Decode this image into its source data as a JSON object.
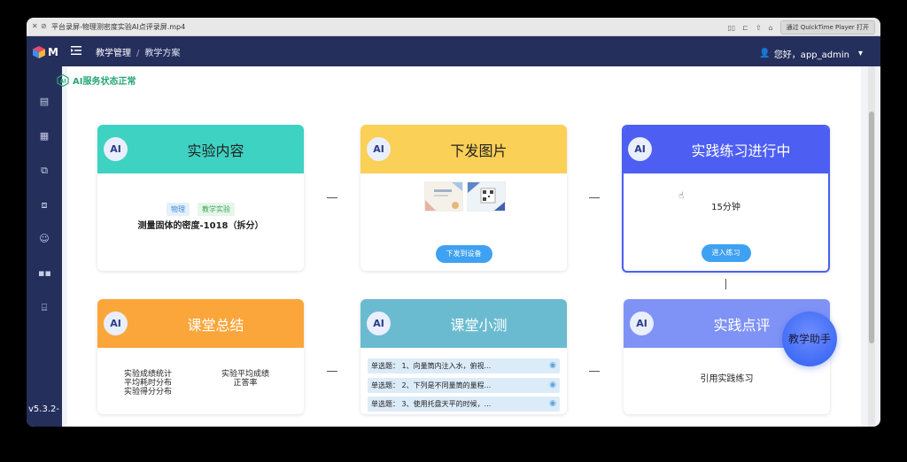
{
  "titlebar": {
    "title": "平台录屏-物理测密度实验AI点评录屏.mp4",
    "open_with_label": "通过 QuickTime Player 打开"
  },
  "sidebar": {
    "logo_text": "M",
    "version": "v5.3.2-",
    "items": [
      {
        "icon": "building-icon"
      },
      {
        "icon": "document-icon"
      },
      {
        "icon": "copy-icon"
      },
      {
        "icon": "files-icon"
      },
      {
        "icon": "smile-icon"
      },
      {
        "icon": "grid-icon"
      },
      {
        "icon": "presentation-icon"
      }
    ]
  },
  "header": {
    "breadcrumb_parent": "教学管理",
    "breadcrumb_sep": "/",
    "breadcrumb_current": "教学方案",
    "user_greeting": "您好，app_admin"
  },
  "ai_status": "AI服务状态正常",
  "ai_badge": "AI",
  "cards": {
    "experiment": {
      "title": "实验内容",
      "tag_subject": "物理",
      "tag_type": "教学实验",
      "name": "测量固体的密度-1018（拆分）",
      "color": "#3ed2c2"
    },
    "images": {
      "title": "下发图片",
      "button": "下发到设备",
      "color": "#fbd056"
    },
    "practice": {
      "title": "实践练习进行中",
      "duration": "15分钟",
      "button": "进入练习",
      "color": "#4d5ff2"
    },
    "summary": {
      "title": "课堂总结",
      "stat_left_1": "实验成绩统计",
      "stat_left_2": "平均耗时分布",
      "stat_left_3": "实验得分分布",
      "stat_right_1": "实验平均成绩",
      "stat_right_2": "正答率",
      "color": "#fba63a"
    },
    "quiz": {
      "title": "课堂小测",
      "items": [
        "单选题： 1、向量筒内注入水，俯视...",
        "单选题： 2、下列是不同量筒的量程...",
        "单选题： 3、使用托盘天平的时候，..."
      ],
      "color": "#6bbbd0"
    },
    "review": {
      "title": "实践点评",
      "text": "引用实践练习",
      "color": "#7f93f6"
    }
  },
  "assistant_label": "教学助手"
}
